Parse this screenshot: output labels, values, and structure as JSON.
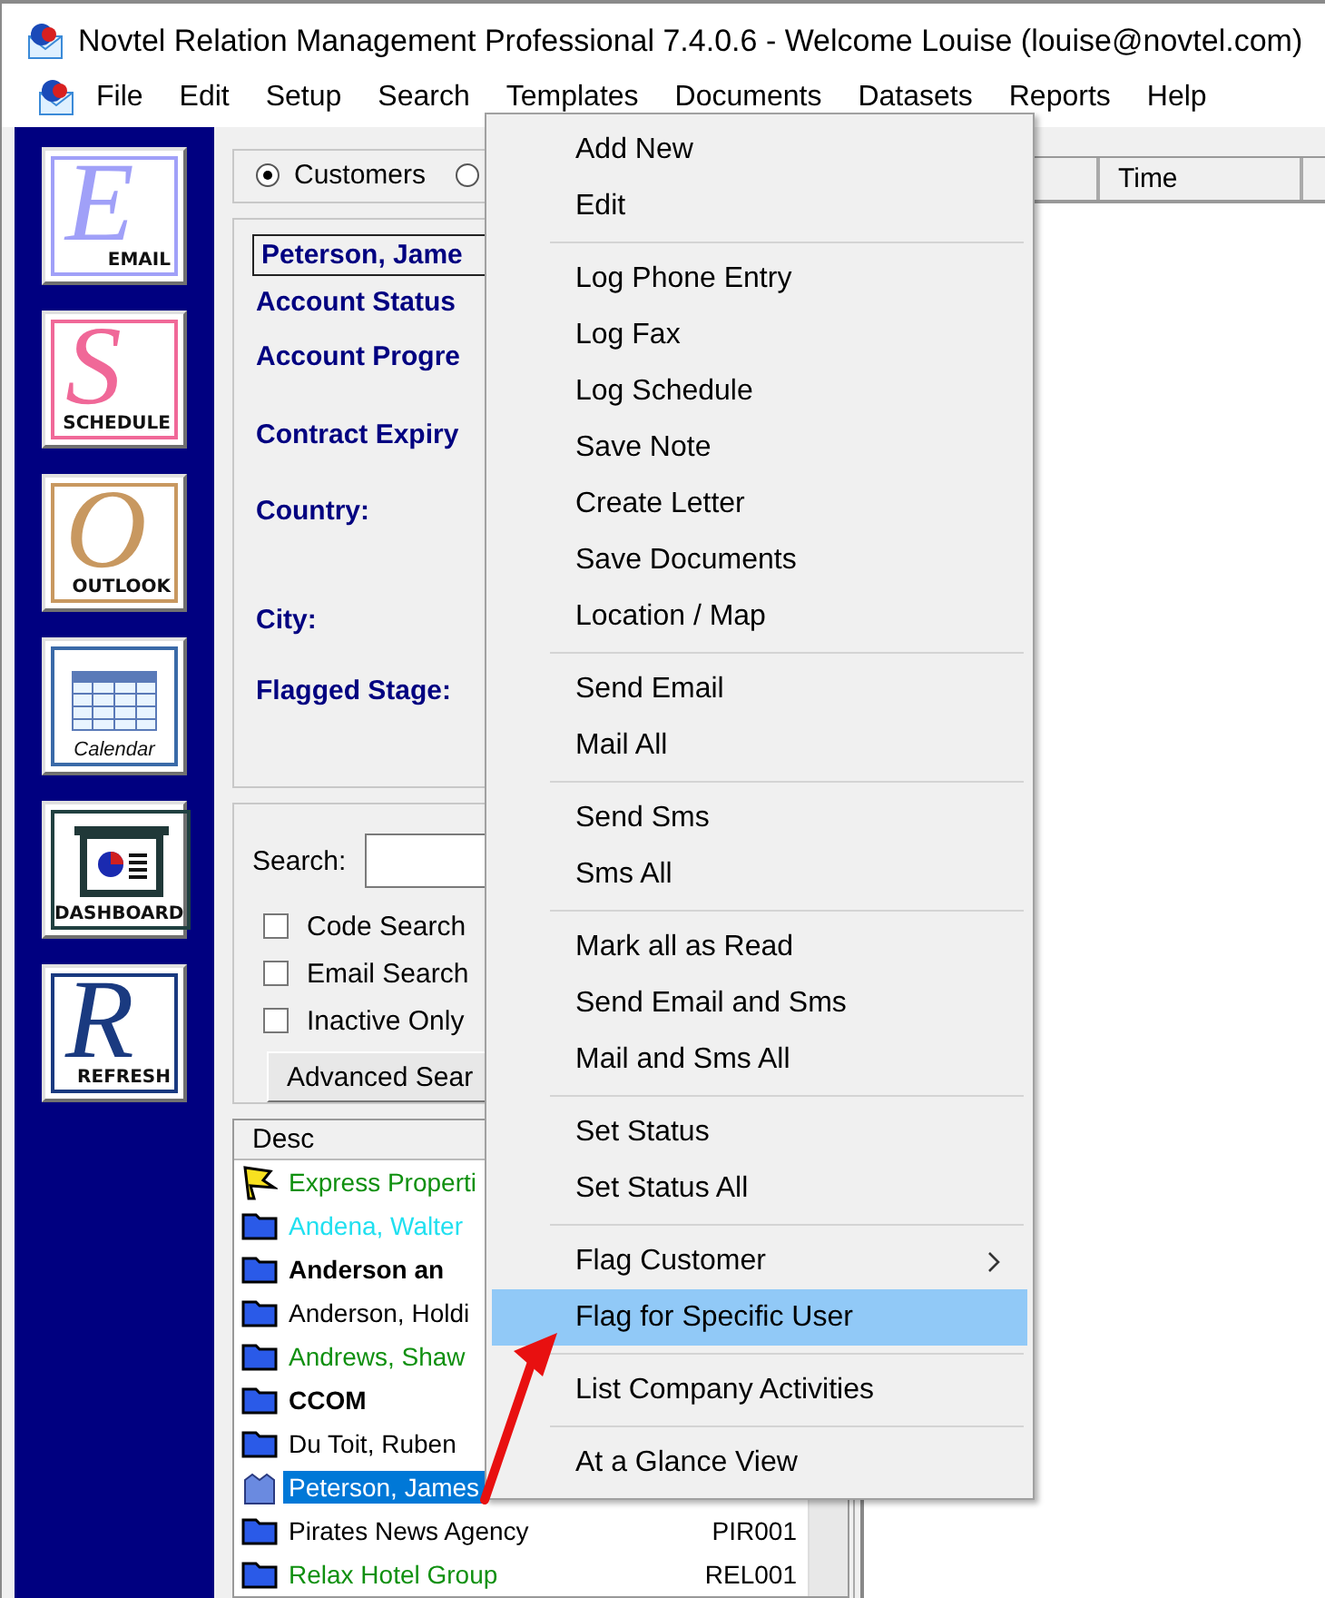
{
  "window": {
    "title": "Novtel Relation Management Professional 7.4.0.6 - Welcome Louise (louise@novtel.com)"
  },
  "menu_bar": [
    "File",
    "Edit",
    "Setup",
    "Search",
    "Templates",
    "Documents",
    "Datasets",
    "Reports",
    "Help"
  ],
  "sidebar": [
    {
      "kind": "letter",
      "letter": "E",
      "label": "EMAIL",
      "color": "#a0a0f8"
    },
    {
      "kind": "letter",
      "letter": "S",
      "label": "SCHEDULE",
      "color": "#f06898"
    },
    {
      "kind": "letter",
      "letter": "O",
      "label": "OUTLOOK",
      "color": "#c89860"
    },
    {
      "kind": "calendar",
      "label": "Calendar",
      "color": "#3a6aa8"
    },
    {
      "kind": "dashboard",
      "label": "DASHBOARD",
      "color": "#204040"
    },
    {
      "kind": "letter",
      "letter": "R",
      "label": "REFRESH",
      "color": "#1a3a80"
    }
  ],
  "mode_radios": [
    {
      "label": "Customers",
      "selected": true
    },
    {
      "selected": false
    }
  ],
  "details": {
    "name": "Peterson, Jame",
    "labels": [
      "Account Status",
      "Account Progre",
      "Contract Expiry",
      "Country:",
      "City:",
      "Flagged Stage:"
    ]
  },
  "search": {
    "label": "Search:",
    "options": [
      {
        "label": "Code Search",
        "checked": false
      },
      {
        "label": "Email Search",
        "checked": false
      },
      {
        "label": "Inactive Only",
        "checked": false
      }
    ],
    "button": "Advanced Sear"
  },
  "customer_list": {
    "columns": [
      "Desc"
    ],
    "rows": [
      {
        "kind": "flag",
        "desc": "Express Properti",
        "code": "",
        "color": "#109010",
        "bold": false,
        "selected": false
      },
      {
        "kind": "folder",
        "desc": "Andena, Walter",
        "code": "",
        "color": "#20e0f0",
        "bold": false,
        "selected": false
      },
      {
        "kind": "folder",
        "desc": "Anderson an",
        "code": "",
        "color": "#000000",
        "bold": true,
        "selected": false
      },
      {
        "kind": "folder",
        "desc": "Anderson, Holdi",
        "code": "",
        "color": "#000000",
        "bold": false,
        "selected": false
      },
      {
        "kind": "folder",
        "desc": "Andrews, Shaw",
        "code": "",
        "color": "#109010",
        "bold": false,
        "selected": false
      },
      {
        "kind": "folder",
        "desc": "CCOM",
        "code": "",
        "color": "#000000",
        "bold": true,
        "selected": false
      },
      {
        "kind": "folder",
        "desc": "Du Toit, Ruben",
        "code": "",
        "color": "#000000",
        "bold": false,
        "selected": false
      },
      {
        "kind": "group",
        "desc": "Peterson, James",
        "code": "",
        "bold": false,
        "selected": true
      },
      {
        "kind": "folder",
        "desc": "Pirates News Agency",
        "code": "PIR001",
        "color": "#000000",
        "bold": false,
        "selected": false
      },
      {
        "kind": "folder",
        "desc": "Relax Hotel Group",
        "code": "REL001",
        "color": "#109010",
        "bold": false,
        "selected": false
      }
    ]
  },
  "activity_list": {
    "columns": [
      "",
      "Time"
    ]
  },
  "context_menu": [
    [
      {
        "label": "Add New",
        "selected": false,
        "submenu": false
      },
      {
        "label": "Edit",
        "selected": false,
        "submenu": false
      }
    ],
    [
      {
        "label": "Log Phone Entry",
        "selected": false,
        "submenu": false
      },
      {
        "label": "Log Fax",
        "selected": false,
        "submenu": false
      },
      {
        "label": "Log Schedule",
        "selected": false,
        "submenu": false
      },
      {
        "label": "Save Note",
        "selected": false,
        "submenu": false
      },
      {
        "label": "Create Letter",
        "selected": false,
        "submenu": false
      },
      {
        "label": "Save Documents",
        "selected": false,
        "submenu": false
      },
      {
        "label": "Location / Map",
        "selected": false,
        "submenu": false
      }
    ],
    [
      {
        "label": "Send Email",
        "selected": false,
        "submenu": false
      },
      {
        "label": "Mail All",
        "selected": false,
        "submenu": false
      }
    ],
    [
      {
        "label": "Send Sms",
        "selected": false,
        "submenu": false
      },
      {
        "label": "Sms All",
        "selected": false,
        "submenu": false
      }
    ],
    [
      {
        "label": "Mark all as Read",
        "selected": false,
        "submenu": false
      },
      {
        "label": "Send Email and Sms",
        "selected": false,
        "submenu": false
      },
      {
        "label": "Mail and Sms All",
        "selected": false,
        "submenu": false
      }
    ],
    [
      {
        "label": "Set Status",
        "selected": false,
        "submenu": false
      },
      {
        "label": "Set Status All",
        "selected": false,
        "submenu": false
      }
    ],
    [
      {
        "label": "Flag Customer",
        "selected": false,
        "submenu": true
      },
      {
        "label": "Flag for Specific User",
        "selected": true,
        "submenu": false
      }
    ],
    [
      {
        "label": "List Company Activities",
        "selected": false,
        "submenu": false
      }
    ],
    [
      {
        "label": "At a Glance View",
        "selected": false,
        "submenu": false
      }
    ]
  ]
}
